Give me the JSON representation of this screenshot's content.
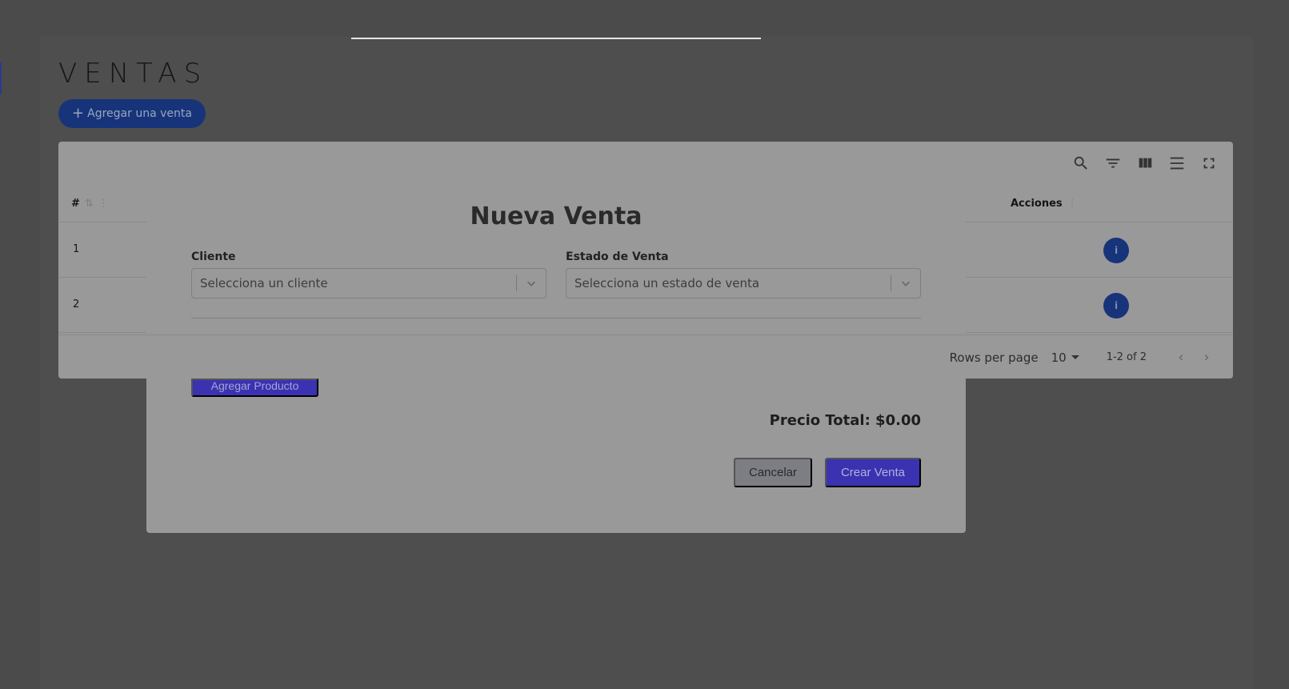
{
  "page": {
    "title": "VENTAS",
    "add_button_label": "Agregar una venta"
  },
  "table": {
    "headers": {
      "id": "#",
      "actions": "Acciones"
    },
    "rows": [
      {
        "id": "1"
      },
      {
        "id": "2"
      }
    ],
    "footer": {
      "rows_per_page_label": "Rows per page",
      "rows_per_page_value": "10",
      "range": "1-2 of 2"
    },
    "toolbar_icons": [
      "search-icon",
      "filter-icon",
      "columns-icon",
      "density-icon",
      "fullscreen-icon"
    ]
  },
  "modal": {
    "title": "Nueva Venta",
    "cliente_label": "Cliente",
    "cliente_placeholder": "Selecciona un cliente",
    "estado_label": "Estado de Venta",
    "estado_placeholder": "Selecciona un estado de venta",
    "add_product_label": "Agregar Producto",
    "total_label": "Precio Total: $0.00",
    "cancel_label": "Cancelar",
    "create_label": "Crear Venta"
  },
  "colors": {
    "overlay_bg": "#4b4b4b",
    "primary": "#3a32b0",
    "accent_blue": "#17347a"
  }
}
